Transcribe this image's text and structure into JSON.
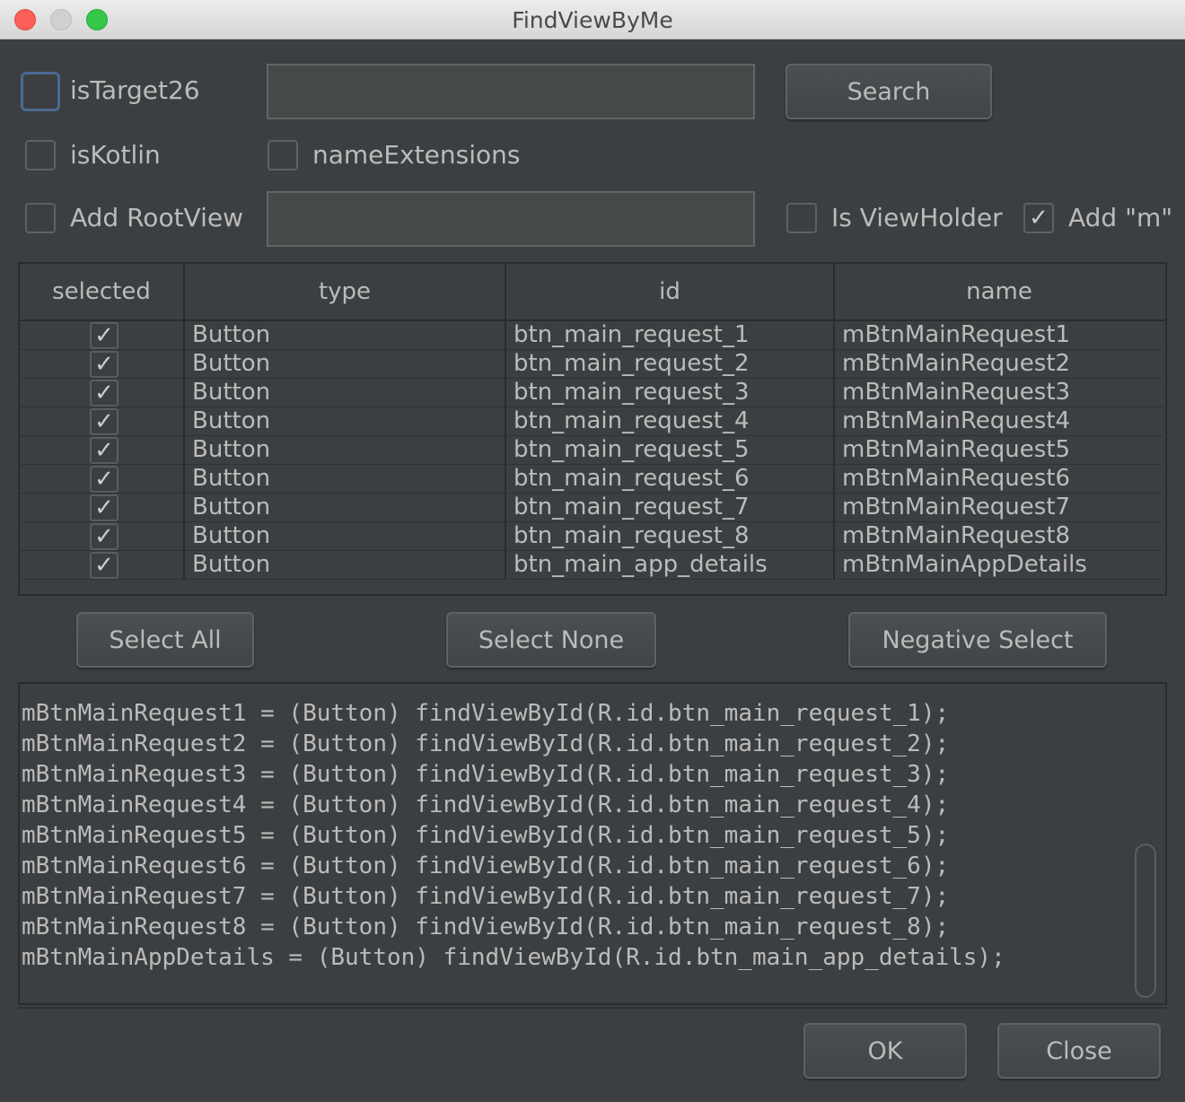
{
  "window": {
    "title": "FindViewByMe"
  },
  "options": {
    "is_target26": {
      "label": "isTarget26",
      "checked": false
    },
    "is_kotlin": {
      "label": "isKotlin",
      "checked": false
    },
    "name_extensions": {
      "label": "nameExtensions",
      "checked": false
    },
    "add_root_view": {
      "label": "Add RootView",
      "checked": false
    },
    "is_view_holder": {
      "label": "Is ViewHolder",
      "checked": false
    },
    "add_m": {
      "label": "Add \"m\"",
      "checked": true
    },
    "search_value": "",
    "root_view_value": "",
    "search_button": "Search"
  },
  "table": {
    "columns": [
      "selected",
      "type",
      "id",
      "name"
    ],
    "rows": [
      {
        "selected": true,
        "type": "Button",
        "id": "btn_main_request_1",
        "name": "mBtnMainRequest1"
      },
      {
        "selected": true,
        "type": "Button",
        "id": "btn_main_request_2",
        "name": "mBtnMainRequest2"
      },
      {
        "selected": true,
        "type": "Button",
        "id": "btn_main_request_3",
        "name": "mBtnMainRequest3"
      },
      {
        "selected": true,
        "type": "Button",
        "id": "btn_main_request_4",
        "name": "mBtnMainRequest4"
      },
      {
        "selected": true,
        "type": "Button",
        "id": "btn_main_request_5",
        "name": "mBtnMainRequest5"
      },
      {
        "selected": true,
        "type": "Button",
        "id": "btn_main_request_6",
        "name": "mBtnMainRequest6"
      },
      {
        "selected": true,
        "type": "Button",
        "id": "btn_main_request_7",
        "name": "mBtnMainRequest7"
      },
      {
        "selected": true,
        "type": "Button",
        "id": "btn_main_request_8",
        "name": "mBtnMainRequest8"
      },
      {
        "selected": true,
        "type": "Button",
        "id": "btn_main_app_details",
        "name": "mBtnMainAppDetails"
      }
    ]
  },
  "selection_buttons": {
    "select_all": "Select All",
    "select_none": "Select None",
    "negative_select": "Negative Select"
  },
  "code_lines": [
    "mBtnMainRequest1 = (Button) findViewById(R.id.btn_main_request_1);",
    "mBtnMainRequest2 = (Button) findViewById(R.id.btn_main_request_2);",
    "mBtnMainRequest3 = (Button) findViewById(R.id.btn_main_request_3);",
    "mBtnMainRequest4 = (Button) findViewById(R.id.btn_main_request_4);",
    "mBtnMainRequest5 = (Button) findViewById(R.id.btn_main_request_5);",
    "mBtnMainRequest6 = (Button) findViewById(R.id.btn_main_request_6);",
    "mBtnMainRequest7 = (Button) findViewById(R.id.btn_main_request_7);",
    "mBtnMainRequest8 = (Button) findViewById(R.id.btn_main_request_8);",
    "mBtnMainAppDetails = (Button) findViewById(R.id.btn_main_app_details);"
  ],
  "footer": {
    "ok": "OK",
    "close": "Close"
  },
  "icons": {
    "checkmark": "checkmark-icon"
  }
}
